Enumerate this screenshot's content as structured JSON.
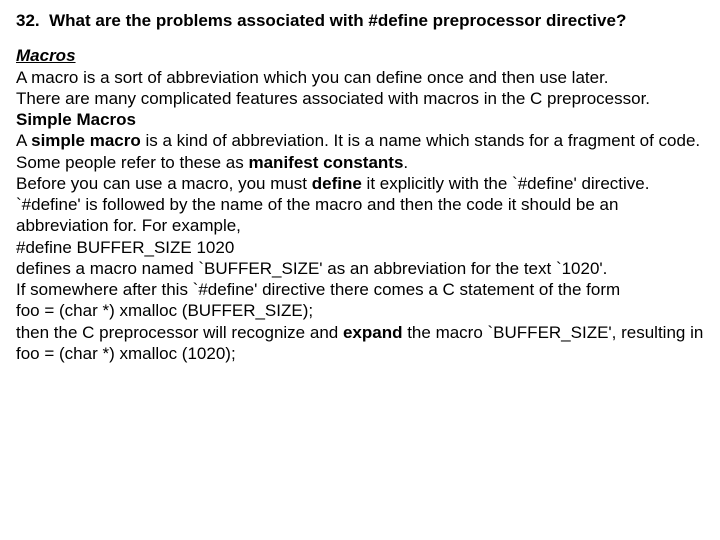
{
  "question": {
    "number": "32.",
    "title": "What are the problems associated with #define preprocessor directive?"
  },
  "macros_head": "Macros",
  "macros_intro_1": "A macro is a sort of abbreviation which you can define once and then use later.",
  "macros_intro_2": "There are many complicated features associated with macros in the C preprocessor.",
  "simple_head": "Simple Macros",
  "simple": {
    "pre_a": "A ",
    "term_simple_macro": "simple macro",
    "post_a": " is a kind of abbreviation. It is a name which stands for a fragment of code. Some people refer to these as ",
    "term_manifest": "manifest constants",
    "post_b": "."
  },
  "define_sentence": {
    "pre": "Before you can use a macro, you must ",
    "term_define": "define",
    "post": " it explicitly with the `#define' directive. `#define' is followed by the name of the macro and then the code it should be an abbreviation for. For example,"
  },
  "code_define": "#define BUFFER_SIZE 1020",
  "explain_1": "defines a macro named `BUFFER_SIZE' as an abbreviation for the text `1020'.",
  "explain_2": "If somewhere after this `#define' directive there comes a C statement of the form",
  "code_foo1": "foo = (char *) xmalloc (BUFFER_SIZE);",
  "expand_sentence": {
    "pre": "then the C preprocessor will recognize and ",
    "term_expand": "expand",
    "post": " the macro `BUFFER_SIZE', resulting in"
  },
  "code_foo2": "foo = (char *) xmalloc (1020);"
}
